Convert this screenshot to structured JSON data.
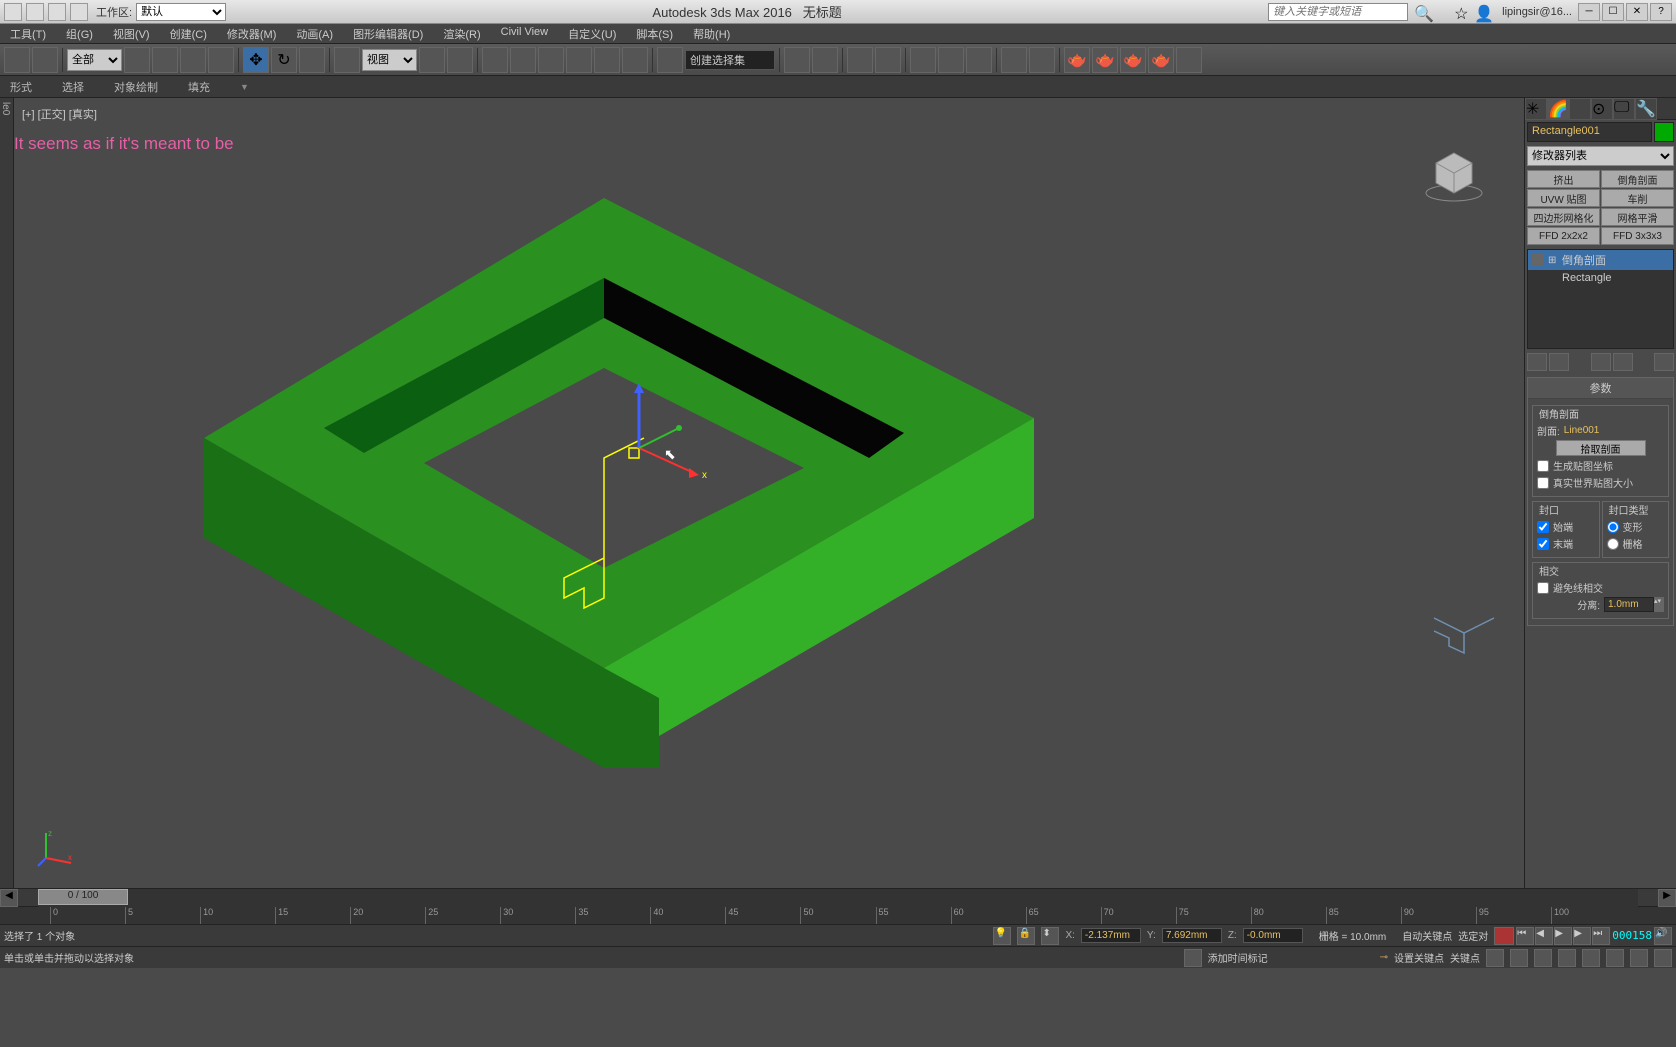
{
  "title_bar": {
    "workspace_label": "工作区:",
    "workspace_value": "默认",
    "app_name": "Autodesk 3ds Max 2016",
    "doc_name": "无标题",
    "search_placeholder": "键入关键字或短语",
    "user": "lipingsir@16..."
  },
  "menus": [
    "工具(T)",
    "组(G)",
    "视图(V)",
    "创建(C)",
    "修改器(M)",
    "动画(A)",
    "图形编辑器(D)",
    "渲染(R)",
    "Civil View",
    "自定义(U)",
    "脚本(S)",
    "帮助(H)"
  ],
  "toolbar": {
    "filter_label": "全部",
    "view_mode": "视图",
    "named_set": "创建选择集"
  },
  "ribbon": [
    "形式",
    "选择",
    "对象绘制",
    "填充"
  ],
  "viewport_label": "[+] [正交] [真实]",
  "caption": "It seems as if it's meant to be",
  "right_panel": {
    "object_name": "Rectangle001",
    "modifier_list_label": "修改器列表",
    "buttons": [
      "挤出",
      "倒角剖面",
      "UVW 贴图",
      "车削",
      "四边形网格化",
      "网格平滑",
      "FFD 2x2x2",
      "FFD 3x3x3"
    ],
    "stack": [
      {
        "name": "倒角剖面",
        "selected": true,
        "expandable": true
      },
      {
        "name": "Rectangle",
        "selected": false,
        "expandable": false
      }
    ],
    "rollout_title": "参数",
    "bevel_profile_group": "倒角剖面",
    "profile_label": "剖面:",
    "profile_value": "Line001",
    "pick_profile_btn": "拾取剖面",
    "gen_coords": "生成贴图坐标",
    "real_world": "真实世界贴图大小",
    "capping_group": "封口",
    "cap_start": "始端",
    "cap_end": "末端",
    "cap_type_group": "封口类型",
    "cap_morph": "变形",
    "cap_grid": "栅格",
    "intersect_group": "相交",
    "avoid_intersect": "避免线相交",
    "separation_label": "分离:",
    "separation_value": "1.0mm"
  },
  "timeline": {
    "slider_text": "0 / 100",
    "ticks": [
      "0",
      "5",
      "10",
      "15",
      "20",
      "25",
      "30",
      "35",
      "40",
      "45",
      "50",
      "55",
      "60",
      "65",
      "70",
      "75",
      "80",
      "85",
      "90",
      "95",
      "100"
    ]
  },
  "status": {
    "selected_text": "选择了 1 个对象",
    "x_label": "X:",
    "x_value": "-2.137mm",
    "y_label": "Y:",
    "y_value": "7.692mm",
    "z_label": "Z:",
    "z_value": "-0.0mm",
    "grid_label": "栅格 = 10.0mm",
    "auto_key": "自动关键点",
    "selected_lock": "选定对",
    "timer": "000158",
    "hint": "单击或单击并拖动以选择对象",
    "add_marker": "添加时间标记",
    "set_key": "设置关键点",
    "key_filter": "关键点"
  }
}
